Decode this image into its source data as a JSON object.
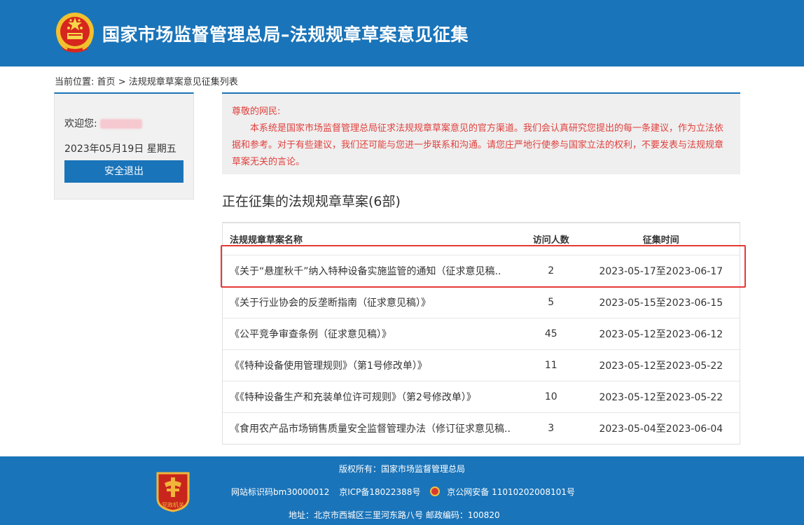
{
  "header": {
    "title": "国家市场监督管理总局–法规规章草案意见征集"
  },
  "breadcrumb": {
    "prefix": "当前位置:",
    "home": "首页",
    "separator": ">",
    "current": "法规规章草案意见征集列表"
  },
  "user_panel": {
    "welcome": "欢迎您:",
    "date": "2023年05月19日 星期五",
    "logout_label": "安全退出"
  },
  "notice": {
    "greeting": "尊敬的网民:",
    "body": "本系统是国家市场监督管理总局征求法规规章草案意见的官方渠道。我们会认真研究您提出的每一条建议，作为立法依据和参考。对于有些建议，我们还可能与您进一步联系和沟通。请您庄严地行使参与国家立法的权利，不要发表与法规规章草案无关的言论。"
  },
  "section": {
    "title": "正在征集的法规规章草案(6部)"
  },
  "table": {
    "headers": [
      "法规规章草案名称",
      "访问人数",
      "征集时间"
    ],
    "rows": [
      {
        "name": "《关于“悬崖秋千”纳入特种设备实施监管的通知（征求意见稿..",
        "visits": "2",
        "period": "2023-05-17至2023-06-17"
      },
      {
        "name": "《关于行业协会的反垄断指南（征求意见稿）》",
        "visits": "5",
        "period": "2023-05-15至2023-06-15"
      },
      {
        "name": "《公平竞争审查条例（征求意见稿）》",
        "visits": "45",
        "period": "2023-05-12至2023-06-12"
      },
      {
        "name": "《《特种设备使用管理规则》（第1号修改单）》",
        "visits": "11",
        "period": "2023-05-12至2023-05-22"
      },
      {
        "name": "《《特种设备生产和充装单位许可规则》（第2号修改单）》",
        "visits": "10",
        "period": "2023-05-12至2023-05-22"
      },
      {
        "name": "《食用农产品市场销售质量安全监督管理办法（修订征求意见稿..",
        "visits": "3",
        "period": "2023-05-04至2023-06-04"
      }
    ]
  },
  "footer": {
    "copyright": "版权所有：国家市场监督管理总局",
    "site_id": "网站标识码bm30000012",
    "icp": "京ICP备18022388号",
    "police": "京公网安备 11010202008101号",
    "address": "地址：北京市西城区三里河东路八号    邮政编码：100820",
    "badge_text": "党政机关"
  },
  "colors": {
    "brand_blue": "#1a74b9",
    "notice_red": "#e0403d",
    "highlight_red": "#e53935"
  },
  "icons": {
    "header_emblem": "national-emblem-icon",
    "footer_badge": "party-government-badge-icon",
    "police": "police-badge-icon"
  }
}
